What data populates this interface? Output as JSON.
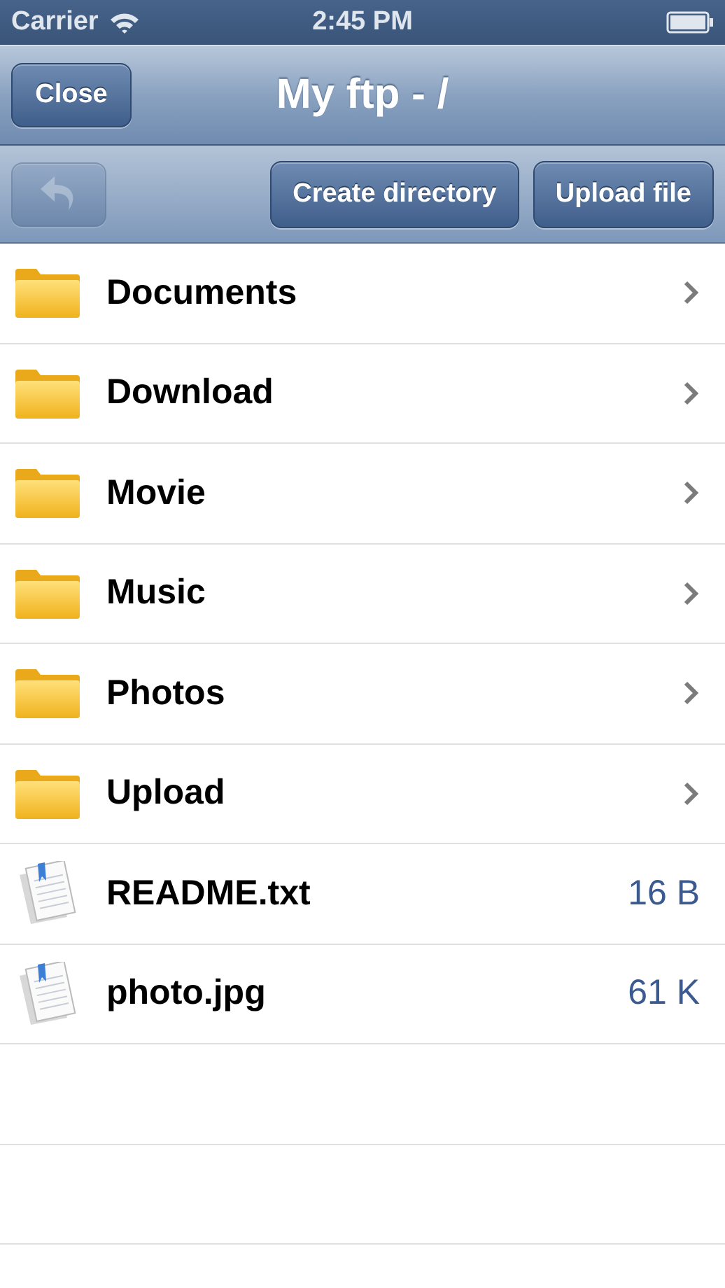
{
  "status_bar": {
    "carrier": "Carrier",
    "time": "2:45 PM"
  },
  "nav_bar": {
    "close_button": "Close",
    "title": "My ftp - /"
  },
  "toolbar": {
    "back_disabled": true,
    "buttons": [
      "Create directory",
      "Upload file"
    ]
  },
  "items": [
    {
      "kind": "folder",
      "name": "Documents"
    },
    {
      "kind": "folder",
      "name": "Download"
    },
    {
      "kind": "folder",
      "name": "Movie"
    },
    {
      "kind": "folder",
      "name": "Music"
    },
    {
      "kind": "folder",
      "name": "Photos"
    },
    {
      "kind": "folder",
      "name": "Upload"
    },
    {
      "kind": "file",
      "name": "README.txt",
      "size": "16 B"
    },
    {
      "kind": "file",
      "name": "photo.jpg",
      "size": "61 K"
    }
  ]
}
